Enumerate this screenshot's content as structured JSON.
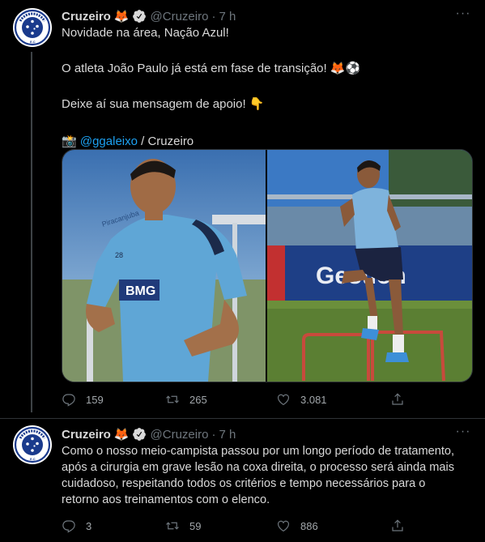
{
  "tweets": [
    {
      "author": {
        "name": "Cruzeiro",
        "name_emoji": "🦊",
        "handle": "@Cruzeiro",
        "time": "7 h",
        "avatar_text": "CRUZEIRO E.C"
      },
      "lines": [
        "Novidade na área, Nação Azul!",
        "",
        "O atleta João Paulo já está em fase de transição! 🦊⚽",
        "",
        "Deixe aí sua mensagem de apoio! 👇",
        ""
      ],
      "credit": {
        "camera_emoji": "📸",
        "mention": "@ggaleixo",
        "suffix": " / Cruzeiro"
      },
      "photos": [
        {
          "icon": "player-jogging-photo",
          "jersey_number": "28",
          "text": "Piracanjuba"
        },
        {
          "icon": "player-training-photo",
          "ad_text": "Gestion"
        }
      ],
      "stats": {
        "replies": "159",
        "retweets": "265",
        "likes": "3.081"
      }
    },
    {
      "author": {
        "name": "Cruzeiro",
        "name_emoji": "🦊",
        "handle": "@Cruzeiro",
        "time": "7 h",
        "avatar_text": "CRUZEIRO E.C"
      },
      "lines": [
        "Como o nosso meio-campista passou por um longo período de tratamento,",
        "após a cirurgia em grave lesão na coxa direita, o processo será ainda mais",
        "cuidadoso, respeitando todos os critérios e tempo necessários para o",
        "retorno aos treinamentos com o elenco."
      ],
      "stats": {
        "replies": "3",
        "retweets": "59",
        "likes": "886"
      }
    }
  ],
  "ui": {
    "dot_separator": "·",
    "more_label": "···"
  },
  "colors": {
    "background": "#000000",
    "text": "#d9d9d9",
    "secondary": "#6e767d",
    "link": "#1da1f2",
    "brand_blue": "#1a3a8c"
  }
}
